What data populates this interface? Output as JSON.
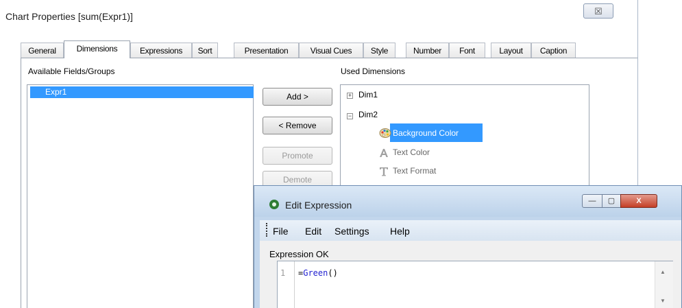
{
  "dialog": {
    "title": "Chart Properties [sum(Expr1)]",
    "close_glyph": "☒"
  },
  "tabs": [
    {
      "label": "General",
      "active": false
    },
    {
      "label": "Dimensions",
      "active": true
    },
    {
      "label": "Expressions",
      "active": false
    },
    {
      "label": "Sort",
      "active": false
    },
    {
      "label": "Presentation",
      "active": false
    },
    {
      "label": "Visual Cues",
      "active": false
    },
    {
      "label": "Style",
      "active": false
    },
    {
      "label": "Number",
      "active": false
    },
    {
      "label": "Font",
      "active": false
    },
    {
      "label": "Layout",
      "active": false
    },
    {
      "label": "Caption",
      "active": false
    }
  ],
  "available": {
    "label": "Available Fields/Groups",
    "items": [
      "Expr1"
    ]
  },
  "used": {
    "label": "Used Dimensions",
    "dim1": {
      "label": "Dim1",
      "expander": "+"
    },
    "dim2": {
      "label": "Dim2",
      "expander": "−",
      "children": [
        "Background Color",
        "Text Color",
        "Text Format"
      ],
      "child_icons": [
        "palette-icon",
        "text-color-icon",
        "text-format-icon"
      ]
    }
  },
  "buttons": {
    "add": "Add >",
    "remove": "< Remove",
    "promote": "Promote",
    "demote": "Demote"
  },
  "edit_expression": {
    "title": "Edit Expression",
    "menu": [
      "File",
      "Edit",
      "Settings",
      "Help"
    ],
    "status": "Expression OK",
    "line_number": "1",
    "code_prefix": "=",
    "code_function": "Green",
    "code_suffix": "()",
    "window_controls": {
      "minimize": "—",
      "maximize": "▢",
      "close": "X"
    }
  },
  "colors": {
    "selection": "#3399ff",
    "function_keyword": "#2020d0",
    "close_button": "#c43f27"
  }
}
